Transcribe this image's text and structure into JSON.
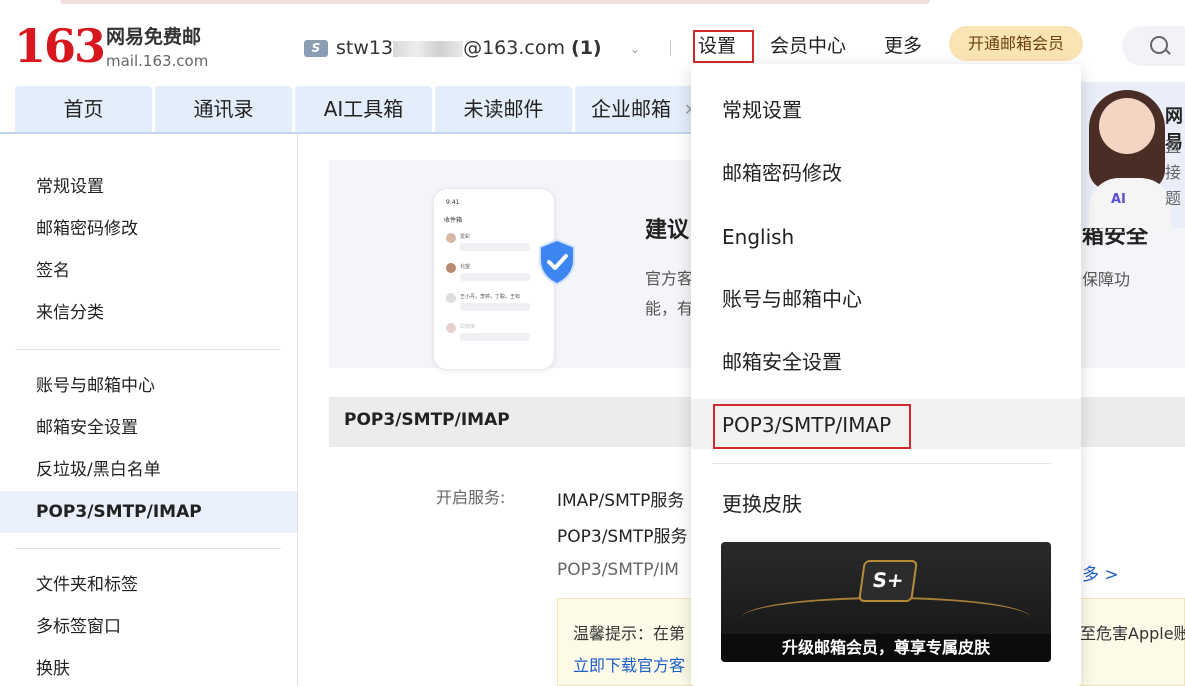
{
  "header": {
    "logo_number": "163",
    "logo_cn": "网易免费邮",
    "logo_en": "mail.163.com",
    "account_prefix": "stw13",
    "account_suffix": "@163.com",
    "account_count": "(1)",
    "nav": [
      "设置",
      "会员中心",
      "更多"
    ],
    "member_button": "开通邮箱会员"
  },
  "tabs": [
    "首页",
    "通讯录",
    "AI工具箱",
    "未读邮件",
    "企业邮箱"
  ],
  "sidebar": {
    "group1": [
      "常规设置",
      "邮箱密码修改",
      "签名",
      "来信分类"
    ],
    "group2": [
      "账号与邮箱中心",
      "邮箱安全设置",
      "反垃圾/黑白名单",
      "POP3/SMTP/IMAP"
    ],
    "group3": [
      "文件夹和标签",
      "多标签窗口",
      "换肤"
    ],
    "active": "POP3/SMTP/IMAP"
  },
  "banner": {
    "title": "建议",
    "title_right": "箱安全",
    "desc_line1": "官方客",
    "desc_line2": "能，有",
    "desc_right": "保障功",
    "phone_header": "收件箱",
    "phone_time": "9:41",
    "phone_rows": [
      "爱彩",
      "北望",
      "王小丹，李婷，丁聪，王标",
      "白衣侠"
    ]
  },
  "section": {
    "title": "POP3/SMTP/IMAP",
    "label": "开启服务:",
    "line1": "IMAP/SMTP服务",
    "line2": "POP3/SMTP服务",
    "line3": "POP3/SMTP/IM",
    "more": "多 >"
  },
  "tip": {
    "text": "温馨提示：在第",
    "link": "立即下载官方客",
    "right": "至危害Apple账"
  },
  "promo": {
    "title": "网易",
    "line1": "直接",
    "line2": "题",
    "ai": "AI"
  },
  "dropdown": {
    "items": [
      "常规设置",
      "邮箱密码修改",
      "English",
      "账号与邮箱中心",
      "邮箱安全设置",
      "POP3/SMTP/IMAP",
      "更换皮肤"
    ],
    "skin_caption": "升级邮箱会员，尊享专属皮肤",
    "skin_badge": "S+"
  },
  "colors": {
    "brand_red": "#d8161e",
    "highlight_red": "#d02a2a",
    "tab_bg": "#e4edfa",
    "member_pill": "#fbe4b4"
  }
}
